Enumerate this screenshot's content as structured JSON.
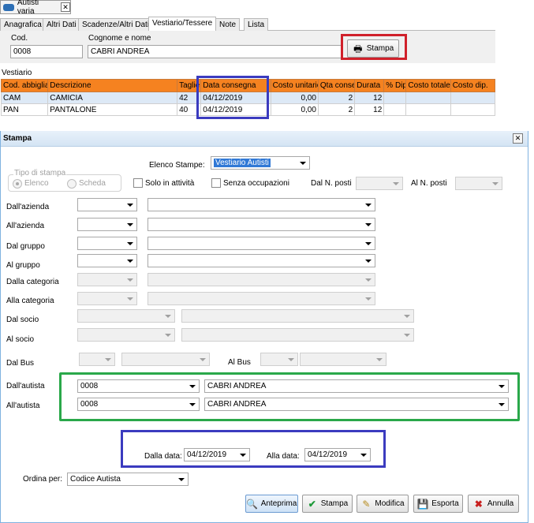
{
  "window": {
    "title": "Autisti varia"
  },
  "tabs": [
    "Anagrafica",
    "Altri Dati",
    "Scadenze/Altri Dati",
    "Vestiario/Tessere",
    "Note",
    "Lista"
  ],
  "header": {
    "cod_label": "Cod.",
    "cod_value": "0008",
    "nome_label": "Cognome e nome",
    "nome_value": "CABRI ANDREA",
    "stampa_button": "Stampa"
  },
  "vestiario": {
    "section_label": "Vestiario",
    "columns": [
      "Cod. abbigliam",
      "Descrizione",
      "Taglie",
      "Data consegna",
      "Costo unitario",
      "Qta conse",
      "Durata",
      "% Dip.",
      "Costo totale",
      "Costo dip."
    ],
    "rows": [
      [
        "CAM",
        "CAMICIA",
        "42",
        "04/12/2019",
        "0,00",
        "2",
        "12",
        "",
        "",
        ""
      ],
      [
        "PAN",
        "PANTALONE",
        "40",
        "04/12/2019",
        "0,00",
        "2",
        "12",
        "",
        "",
        ""
      ]
    ]
  },
  "dialog": {
    "title": "Stampa",
    "close_icon": "close-icon",
    "elenco_label": "Elenco Stampe:",
    "elenco_value": "Vestiario Autisti",
    "tipo_stampa_label": "Tipo di stampa",
    "radio_elenco": "Elenco",
    "radio_scheda": "Scheda",
    "solo_attivita": "Solo in attività",
    "senza_occupazioni": "Senza occupazioni",
    "dal_n_posti": "Dal N. posti",
    "al_n_posti": "Al N. posti",
    "dal_azienda": "Dall'azienda",
    "al_azienda": "All'azienda",
    "dal_gruppo": "Dal gruppo",
    "al_gruppo": "Al gruppo",
    "dalla_categoria": "Dalla categoria",
    "alla_categoria": "Alla categoria",
    "dal_socio": "Dal socio",
    "al_socio": "Al socio",
    "dal_bus": "Dal Bus",
    "al_bus": "Al Bus",
    "dal_autista": "Dall'autista",
    "al_autista": "All'autista",
    "dal_autista_cod": "0008",
    "dal_autista_nome": "CABRI ANDREA",
    "al_autista_cod": "0008",
    "al_autista_nome": "CABRI ANDREA",
    "dalla_data_label": "Dalla data:",
    "dalla_data_value": "04/12/2019",
    "alla_data_label": "Alla data:",
    "alla_data_value": "04/12/2019",
    "ordina_label": "Ordina per:",
    "ordina_value": "Codice Autista",
    "buttons": {
      "anteprima": "Anteprima",
      "stampa": "Stampa",
      "modifica": "Modifica",
      "esporta": "Esporta",
      "annulla": "Annulla"
    }
  },
  "colors": {
    "grid_header": "#f58220",
    "highlight_red": "#d0202a",
    "highlight_blue": "#3b3bbf",
    "highlight_green": "#2aa84a",
    "dialog_border": "#7fb2e0"
  }
}
